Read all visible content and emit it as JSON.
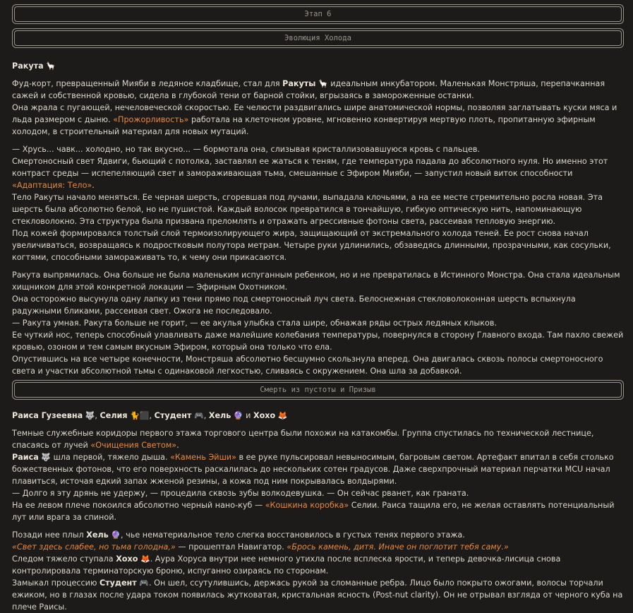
{
  "banners": {
    "stage": "Этап 6",
    "evolution": "Эволюция Холода",
    "death": "Смерть из пустоты и Призыв"
  },
  "emoji": {
    "llama": "🦙",
    "wolf": "🐺",
    "dog": "🐈",
    "square": "⬛",
    "gamepad": "🎮",
    "orb": "🔮",
    "fox": "🦊"
  },
  "s1": {
    "header_name": "Ракута",
    "p1_a": "Фуд-корт, превращенный Мияби в ледяное кладбище, стал для ",
    "p1_name": "Ракуты",
    "p1_b": " идеальным инкубатором. Маленькая Монстряша, перепачканная сажей и собственной кровью, сидела в глубокой тени от барной стойки, вгрызаясь в замороженные останки.",
    "p2_a": "Она жрала с пугающей, нечеловеческой скоростью. Ее челюсти раздвигались шире анатомической нормы, позволяя заглатывать куски мяса и льда размером с дыню. ",
    "p2_hl": "«Прожорливость»",
    "p2_b": " работала на клеточном уровне, мгновенно конвертируя мертвую плоть, пропитанную эфирным холодом, в строительный материал для новых мутаций.",
    "p3": "— Хрусь... чавк... холодно, но так вкусно... — бормотала она, слизывая кристаллизовавшуюся кровь с пальцев.",
    "p4_a": "Смертоносный свет Ядвиги, бьющий с потолка, заставлял ее жаться к теням, где температура падала до абсолютного нуля. Но именно этот контраст среды — испепеляющий свет и замораживающая тьма, смешанные с Эфиром Мияби, — запустил новый виток способности ",
    "p4_hl": "«Адаптация: Тело»",
    "p4_b": ".",
    "p5": "Тело Ракуты начало меняться. Ее черная шерсть, сгоревшая под лучами, выпадала клочьями, а на ее месте стремительно росла новая. Эта шерсть была абсолютно белой, но не пушистой. Каждый волосок превратился в тончайшую, гибкую оптическую нить, напоминающую стекловолокно. Эта структура была призвана преломлять и отражать агрессивные фотоны света, рассеивая тепловую энергию.",
    "p6": "Под кожей формировался толстый слой термоизолирующего жира, защищающий от экстремального холода теней. Ее рост снова начал увеличиваться, возвращаясь к подростковым полутора метрам. Четыре руки удлинились, обзаведясь длинными, прозрачными, как сосульки, когтями, способными замораживать то, к чему они прикасаются.",
    "p7": "Ракута выпрямилась. Она больше не была маленьким испуганным ребенком, но и не превратилась в Истинного Монстра. Она стала идеальным хищником для этой конкретной локации — Эфирным Охотником.",
    "p8": "Она осторожно высунула одну лапку из тени прямо под смертоносный луч света. Белоснежная стекловолоконная шерсть вспыхнула радужными бликами, рассеивая свет. Ожога не последовало.",
    "p9": "— Ракута умная. Ракута больше не горит, — ее акулья улыбка стала шире, обнажая ряды острых ледяных клыков.",
    "p10": "Ее чуткий нос, теперь способный улавливать даже малейшие колебания температуры, повернулся в сторону Главного входа. Там пахло свежей кровью, озоном и тем самым вкусным Эфиром, который она только что ела.",
    "p11": "Опустившись на все четыре конечности, Монстряша абсолютно бесшумно скользнула вперед. Она двигалась сквозь полосы смертоносного света и участки абсолютной тьмы с одинаковой легкостью, сливаясь с окружением. Она шла за добавкой."
  },
  "s2": {
    "h_raisa": "Раиса Гузеевна",
    "h_sep1": ", ",
    "h_selia": "Селия",
    "h_sep2": ", ",
    "h_student": "Студент",
    "h_sep3": ", ",
    "h_hel": "Хель",
    "h_and": " и ",
    "h_hoho": "Хохо",
    "p1_a": "Темные служебные коридоры первого этажа торгового центра были похожи на катакомбы. Группа спустилась по технической лестнице, спасаясь от лучей ",
    "p1_hl": "«Очищения Светом»",
    "p1_b": ".",
    "p2_name": "Раиса",
    "p2_a": " шла первой, тяжело дыша. ",
    "p2_hl": "«Камень Эйши»",
    "p2_b": " в ее руке пульсировал невыносимым, багровым светом. Артефакт впитал в себя столько божественных фотонов, что его поверхность раскалилась до нескольких сотен градусов. Даже сверхпрочный материал перчатки MCU начал плавиться, источая едкий запах жженой резины, а кожа под ним покрывалась волдырями.",
    "p3": "— Долго я эту дрянь не удержу, — процедила сквозь зубы волкодевушка. — Он сейчас рванет, как граната.",
    "p4_a": "На ее левом плече покоился абсолютно черный нано-куб — ",
    "p4_hl": "«Кошкина коробка»",
    "p4_b": " Селии. Раиса тащила его, не желая оставлять потенциальный лут или врага за спиной.",
    "p5_a": "Позади нее плыл ",
    "p5_name": "Хель",
    "p5_b": ", чье нематериальное тело слегка восстановилось в густых тенях первого этажа.",
    "p6_q1": "«Свет здесь слабее, но тьма голодна,»",
    "p6_mid": " — прошептал Навигатор. ",
    "p6_q2": "«Брось камень, дитя. Иначе он поглотит тебя саму.»",
    "p7_a": "Следом тяжело ступала ",
    "p7_name": "Хохо",
    "p7_b": ". Аура Хоруса внутри нее немного утихла после всплеска ярости, и теперь девочка-лисица снова контролировала терминаторскую броню, испуганно озираясь по сторонам.",
    "p8_a": "Замыкал процессию ",
    "p8_name": "Студент",
    "p8_b": ". Он шел, ссутулившись, держась рукой за сломанные ребра. Лицо было покрыто ожогами, волосы торчали ежиком, но в глазах после удара током появилась жутковатая, кристальная ясность (Post-nut clarity). Он не отрывал взгляда от черного куба на плече Раисы."
  }
}
